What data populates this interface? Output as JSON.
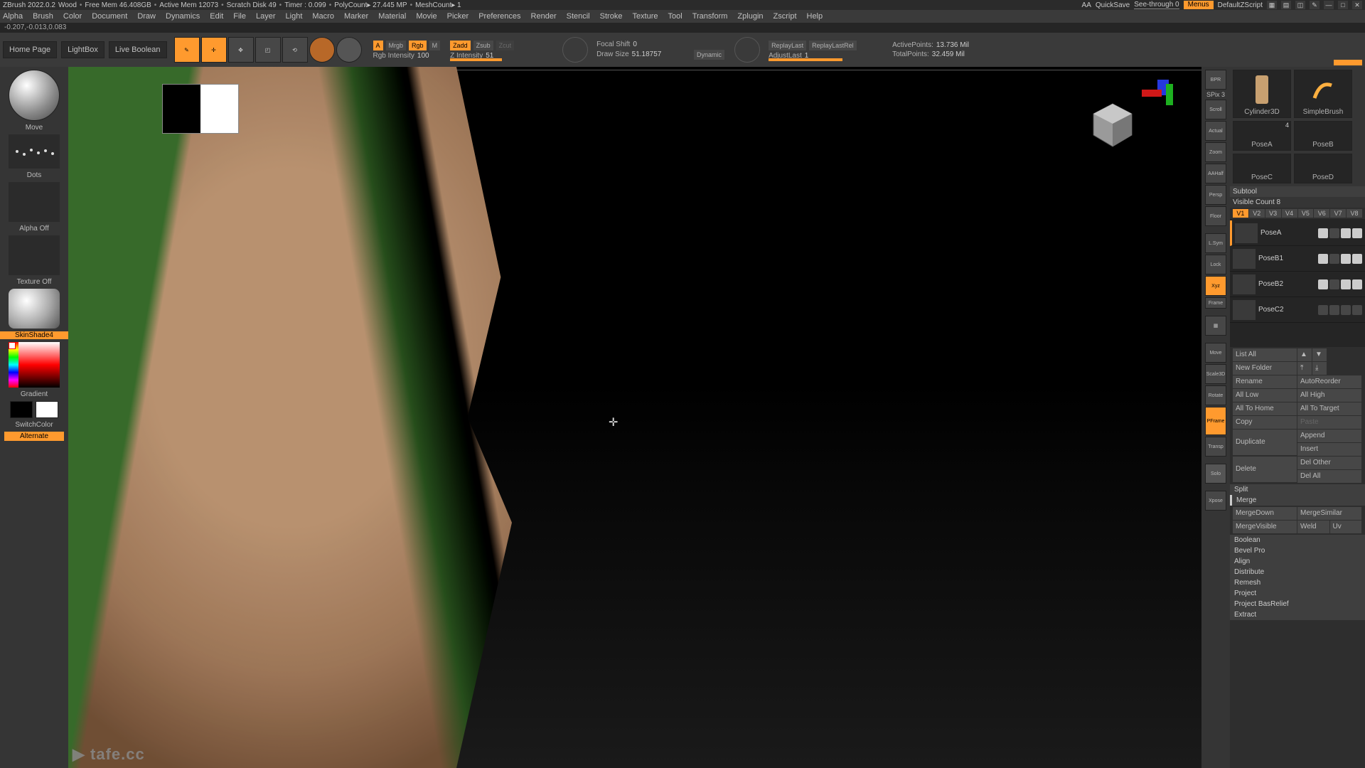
{
  "titlebar": {
    "app": "ZBrush 2022.0.2",
    "project": "Wood",
    "freemem": "Free Mem 46.408GB",
    "activemem": "Active Mem 12073",
    "scratch": "Scratch Disk 49",
    "timer": "Timer : 0.099",
    "polycount": "PolyCount▸ 27.445 MP",
    "meshcount": "MeshCount▸ 1",
    "aa": "AA",
    "quicksave": "QuickSave",
    "seethrough": "See-through  0",
    "menus": "Menus",
    "script": "DefaultZScript"
  },
  "menu": [
    "Alpha",
    "Brush",
    "Color",
    "Document",
    "Draw",
    "Dynamics",
    "Edit",
    "File",
    "Layer",
    "Light",
    "Macro",
    "Marker",
    "Material",
    "Movie",
    "Picker",
    "Preferences",
    "Render",
    "Stencil",
    "Stroke",
    "Texture",
    "Tool",
    "Transform",
    "Zplugin",
    "Zscript",
    "Help"
  ],
  "status": "-0.207,-0.013,0.083",
  "shelf": {
    "home": "Home Page",
    "lightbox": "LightBox",
    "live": "Live Boolean",
    "mrgb_m": "M",
    "mrgb": "Mrgb",
    "rgb": "Rgb",
    "rgb_intensity_label": "Rgb Intensity",
    "rgb_intensity_val": "100",
    "zadd": "Zadd",
    "zsub": "Zsub",
    "z_intensity_label": "Z Intensity",
    "z_intensity_val": "51",
    "focal_label": "Focal Shift",
    "focal_val": "0",
    "drawsize_label": "Draw Size",
    "drawsize_val": "51.18757",
    "dynamic": "Dynamic",
    "replaylast": "ReplayLast",
    "replaylastrel": "ReplayLastRel",
    "adjustlast_label": "AdjustLast",
    "adjustlast_val": "1",
    "activepoints_label": "ActivePoints:",
    "activepoints_val": "13.736 Mil",
    "totalpoints_label": "TotalPoints:",
    "totalpoints_val": "32.459 Mil"
  },
  "left": {
    "brush": "Move",
    "stroke": "Dots",
    "alpha": "Alpha Off",
    "texture": "Texture Off",
    "material": "SkinShade4",
    "gradient": "Gradient",
    "switchcolor": "SwitchColor",
    "alternate": "Alternate"
  },
  "rightStrip": {
    "spix": "SPix 3",
    "items": [
      "BPR",
      "Scroll",
      "Actual",
      "Zoom",
      "AAHalf",
      "Persp",
      "Floor",
      "L.Sym",
      "Lock",
      "Xyz",
      "Frame",
      "Move",
      "Scale3D",
      "Rotate",
      "PFrame",
      "Transp",
      "Solo",
      "Xpose"
    ]
  },
  "tools": {
    "row1": [
      {
        "name": "Cylinder3D"
      },
      {
        "name": "SimpleBrush"
      }
    ],
    "row2": [
      {
        "name": "PoseA",
        "badge": "4"
      },
      {
        "name": "PoseB"
      }
    ],
    "row3": [
      {
        "name": "PoseC"
      },
      {
        "name": "PoseD"
      }
    ]
  },
  "subtool": {
    "header": "Subtool",
    "visible": "Visible Count 8",
    "vis": [
      "V1",
      "V2",
      "V3",
      "V4",
      "V5",
      "V6",
      "V7",
      "V8"
    ],
    "items": [
      {
        "name": "PoseA",
        "active": true
      },
      {
        "name": "PoseB1"
      },
      {
        "name": "PoseB2"
      },
      {
        "name": "PoseC2"
      }
    ],
    "listall": "List All",
    "newfolder": "New Folder",
    "rename": "Rename",
    "autoreorder": "AutoReorder",
    "alllow": "All Low",
    "allhigh": "All High",
    "alltohome": "All To Home",
    "alltotarget": "All To Target",
    "copy": "Copy",
    "paste": "Paste",
    "duplicate": "Duplicate",
    "append": "Append",
    "insert": "Insert",
    "delete": "Delete",
    "delother": "Del Other",
    "delall": "Del All",
    "split": "Split",
    "merge": "Merge",
    "mergedown": "MergeDown",
    "mergesimilar": "MergeSimilar",
    "mergevisible": "MergeVisible",
    "weld": "Weld",
    "uv": "Uv",
    "boolean": "Boolean",
    "bevelpro": "Bevel Pro",
    "align": "Align",
    "distribute": "Distribute",
    "remesh": "Remesh",
    "project": "Project",
    "projectbas": "Project BasRelief",
    "extract": "Extract"
  },
  "logo": "tafe.cc"
}
